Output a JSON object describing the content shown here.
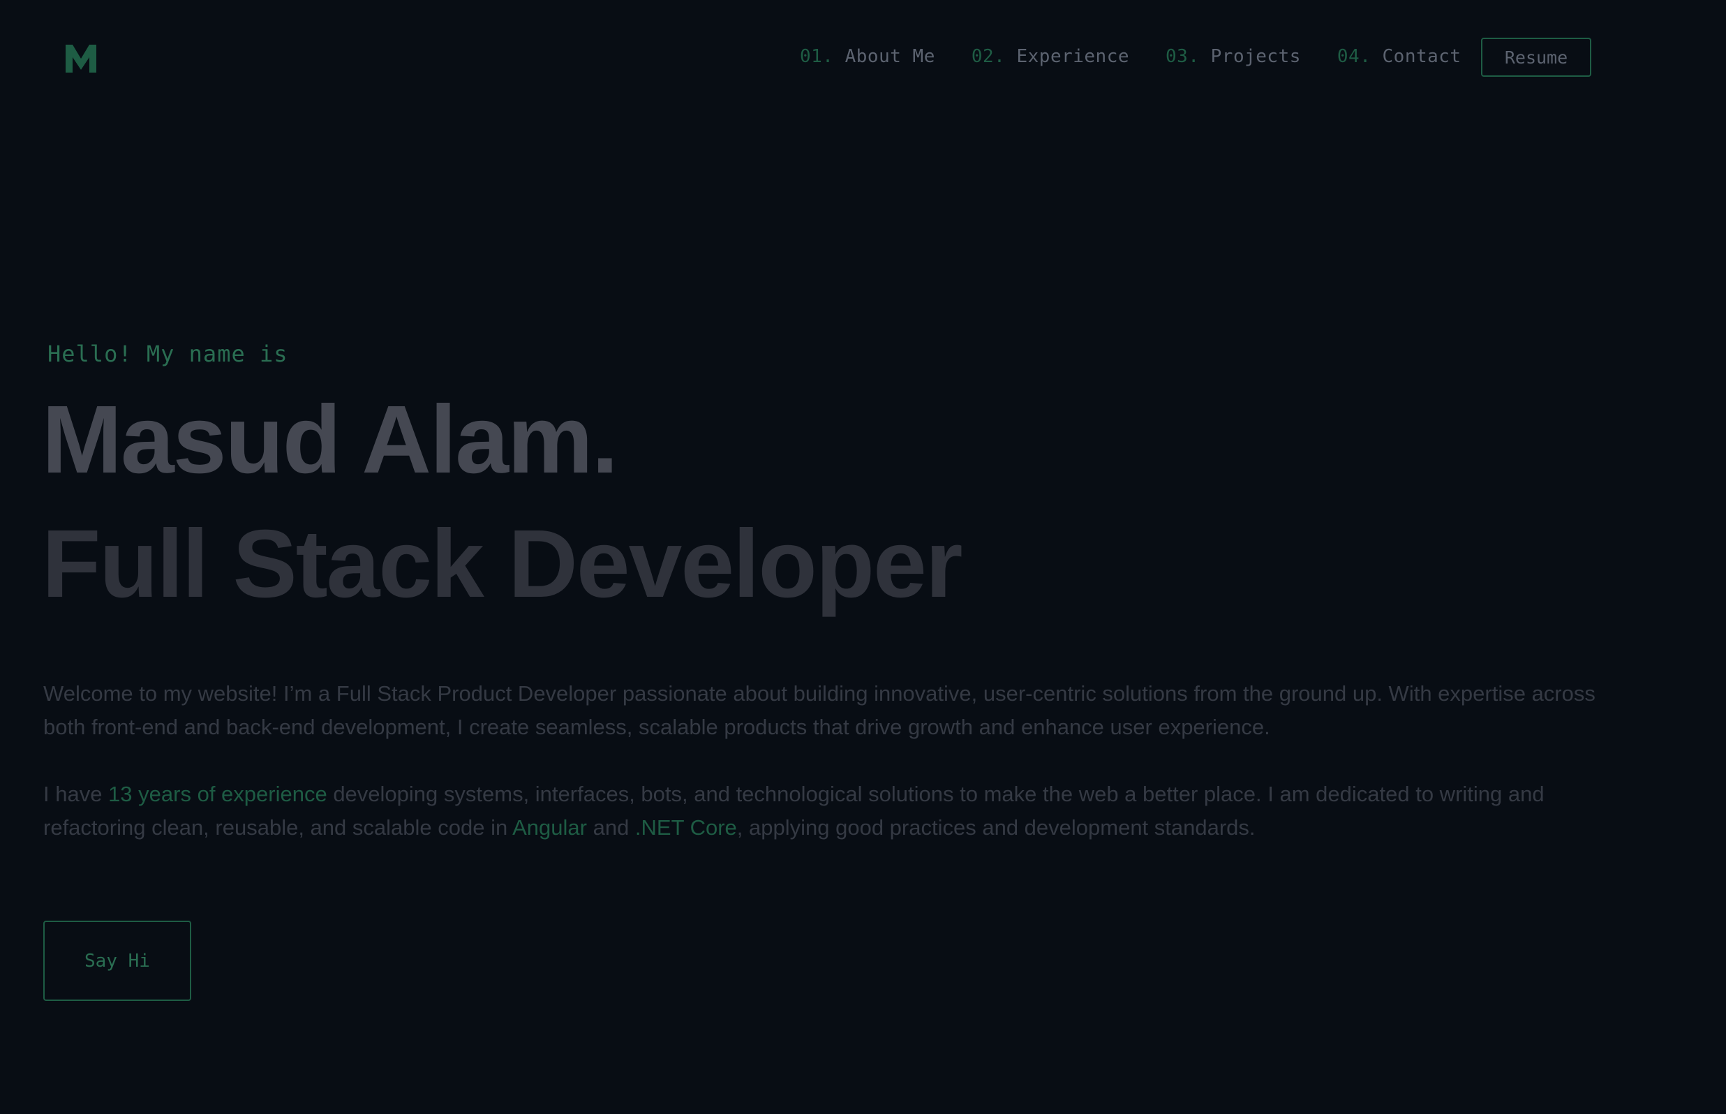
{
  "header": {
    "logo_icon": "m-logo-icon",
    "nav": [
      {
        "num": "01.",
        "label": "About Me"
      },
      {
        "num": "02.",
        "label": "Experience"
      },
      {
        "num": "03.",
        "label": "Projects"
      },
      {
        "num": "04.",
        "label": "Contact"
      }
    ],
    "resume_label": "Resume"
  },
  "hero": {
    "greeting": "Hello! My name is",
    "name": "Masud Alam.",
    "role": "Full Stack Developer",
    "para1": "Welcome to my website! I’m a Full Stack Product Developer passionate about building innovative, user-centric solutions from the ground up. With expertise across both front-end and back-end development, I create seamless, scalable products that drive growth and enhance user experience.",
    "para2": {
      "p1": "I have ",
      "h1": "13 years of experience",
      "p2": " developing systems, interfaces, bots, and technological solutions to make the web a better place. I am dedicated to writing and refactoring clean, reusable, and scalable code in ",
      "h2": "Angular",
      "p3": " and ",
      "h3": ".NET Core",
      "p4": ", applying good practices and development standards."
    },
    "cta_label": "Say Hi"
  },
  "colors": {
    "background": "#080d14",
    "accent": "#1e5c44",
    "name_text": "#454852",
    "role_text": "#2f323b",
    "body_text": "#353a44"
  }
}
